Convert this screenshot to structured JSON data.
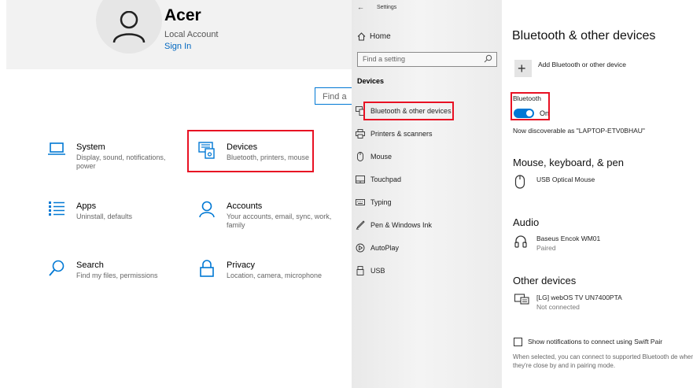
{
  "account": {
    "name": "Acer",
    "type": "Local Account",
    "sign_in": "Sign In"
  },
  "home_search": {
    "placeholder": "Find a"
  },
  "categories": [
    {
      "title": "System",
      "subtitle": "Display, sound, notifications, power"
    },
    {
      "title": "Devices",
      "subtitle": "Bluetooth, printers, mouse"
    },
    {
      "title": "Apps",
      "subtitle": "Uninstall, defaults"
    },
    {
      "title": "Accounts",
      "subtitle": "Your accounts, email, sync, work, family"
    },
    {
      "title": "Search",
      "subtitle": "Find my files, permissions"
    },
    {
      "title": "Privacy",
      "subtitle": "Location, camera, microphone"
    }
  ],
  "settings_nav": {
    "back": "←",
    "window_title": "Settings",
    "home": "Home",
    "search_placeholder": "Find a setting",
    "section": "Devices",
    "items": [
      {
        "label": "Bluetooth & other devices",
        "icon": "bluetooth-devices-icon"
      },
      {
        "label": "Printers & scanners",
        "icon": "printer-icon"
      },
      {
        "label": "Mouse",
        "icon": "mouse-icon"
      },
      {
        "label": "Touchpad",
        "icon": "touchpad-icon"
      },
      {
        "label": "Typing",
        "icon": "keyboard-icon"
      },
      {
        "label": "Pen & Windows Ink",
        "icon": "pen-icon"
      },
      {
        "label": "AutoPlay",
        "icon": "autoplay-icon"
      },
      {
        "label": "USB",
        "icon": "usb-icon"
      }
    ]
  },
  "bt_page": {
    "title": "Bluetooth & other devices",
    "add_device": "Add Bluetooth or other device",
    "bluetooth_label": "Bluetooth",
    "toggle_state": "On",
    "discoverable": "Now discoverable as \"LAPTOP-ETV0BHAU\"",
    "mouse_section": "Mouse, keyboard, & pen",
    "mouse_device": "USB Optical Mouse",
    "audio_section": "Audio",
    "audio_device": "Baseus Encok WM01",
    "audio_status": "Paired",
    "other_section": "Other devices",
    "other_device": "[LG] webOS TV UN7400PTA",
    "other_status": "Not connected",
    "swift_pair_label": "Show notifications to connect using Swift Pair",
    "swift_pair_desc": "When selected, you can connect to supported Bluetooth de when they're close by and in pairing mode."
  },
  "colors": {
    "accent": "#0078d4",
    "highlight": "#e81123",
    "link": "#0067c0"
  }
}
